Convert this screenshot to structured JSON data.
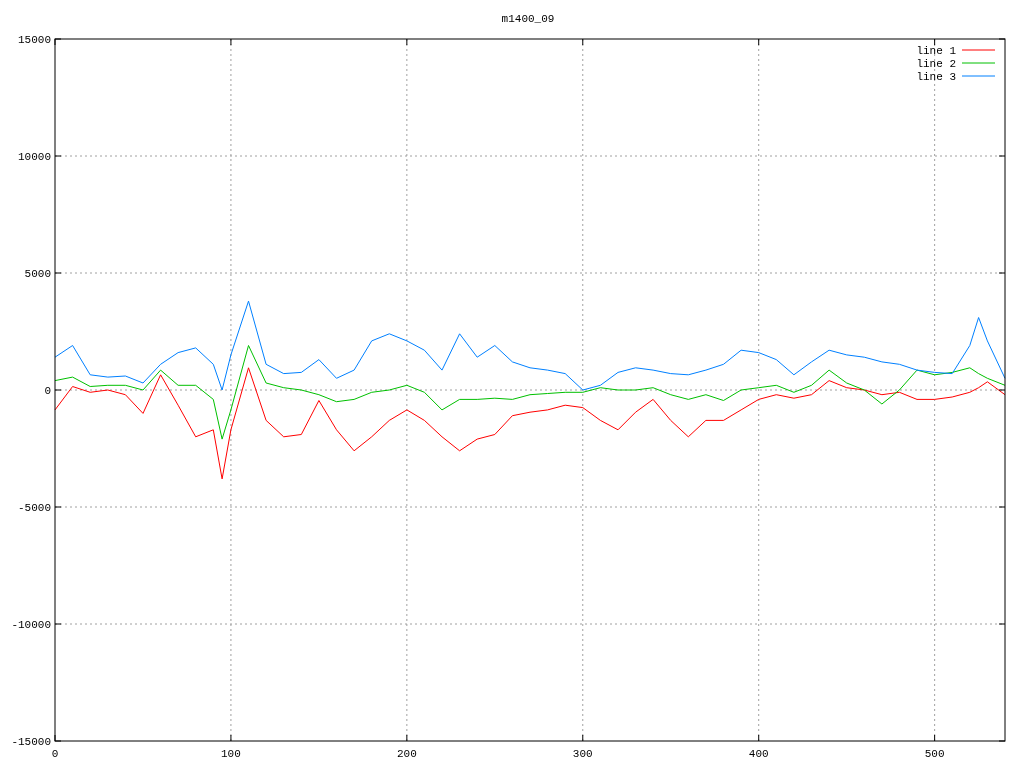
{
  "chart": {
    "chart_data": {
      "type": "line",
      "title": "m1400_09",
      "x": [
        0,
        10,
        20,
        30,
        40,
        50,
        60,
        70,
        80,
        90,
        95,
        100,
        110,
        120,
        130,
        140,
        150,
        160,
        170,
        180,
        190,
        200,
        210,
        220,
        230,
        240,
        250,
        260,
        270,
        280,
        290,
        300,
        310,
        320,
        330,
        340,
        350,
        360,
        370,
        380,
        390,
        400,
        410,
        420,
        430,
        440,
        450,
        460,
        470,
        480,
        490,
        500,
        510,
        520,
        525,
        530,
        540
      ],
      "series": [
        {
          "name": "line 1",
          "color": "#ff0000",
          "values": [
            -850,
            150,
            -100,
            0,
            -200,
            -1000,
            650,
            -650,
            -2000,
            -1700,
            -3800,
            -1700,
            950,
            -1300,
            -2000,
            -1900,
            -450,
            -1700,
            -2600,
            -2000,
            -1300,
            -850,
            -1300,
            -2000,
            -2600,
            -2100,
            -1900,
            -1100,
            -950,
            -850,
            -650,
            -750,
            -1300,
            -1700,
            -950,
            -400,
            -1300,
            -2000,
            -1300,
            -1300,
            -850,
            -400,
            -200,
            -350,
            -200,
            400,
            100,
            0,
            -200,
            -100,
            -400,
            -400,
            -300,
            -100,
            100,
            350,
            -200
          ]
        },
        {
          "name": "line 2",
          "color": "#00c000",
          "values": [
            400,
            550,
            150,
            200,
            200,
            0,
            850,
            200,
            200,
            -400,
            -2100,
            -850,
            1900,
            300,
            100,
            0,
            -200,
            -500,
            -400,
            -100,
            0,
            200,
            -100,
            -850,
            -400,
            -400,
            -350,
            -400,
            -200,
            -150,
            -100,
            -100,
            100,
            0,
            0,
            100,
            -200,
            -400,
            -200,
            -450,
            0,
            100,
            200,
            -100,
            200,
            850,
            300,
            0,
            -600,
            0,
            850,
            650,
            750,
            950,
            700,
            500,
            200
          ]
        },
        {
          "name": "line 3",
          "color": "#0080ff",
          "values": [
            1400,
            1900,
            650,
            550,
            600,
            300,
            1100,
            1600,
            1800,
            1100,
            0,
            1500,
            3800,
            1100,
            700,
            750,
            1300,
            500,
            850,
            2100,
            2400,
            2100,
            1700,
            850,
            2400,
            1400,
            1900,
            1200,
            950,
            850,
            700,
            0,
            200,
            750,
            950,
            850,
            700,
            650,
            850,
            1100,
            1700,
            1600,
            1300,
            650,
            1200,
            1700,
            1500,
            1400,
            1200,
            1100,
            850,
            750,
            700,
            1900,
            3100,
            2100,
            500
          ]
        }
      ],
      "xlim": [
        0,
        540
      ],
      "ylim": [
        -15000,
        15000
      ],
      "xticks": [
        0,
        100,
        200,
        300,
        400,
        500
      ],
      "yticks": [
        -15000,
        -10000,
        -5000,
        0,
        5000,
        10000,
        15000
      ],
      "grid": true,
      "legend": true
    }
  }
}
